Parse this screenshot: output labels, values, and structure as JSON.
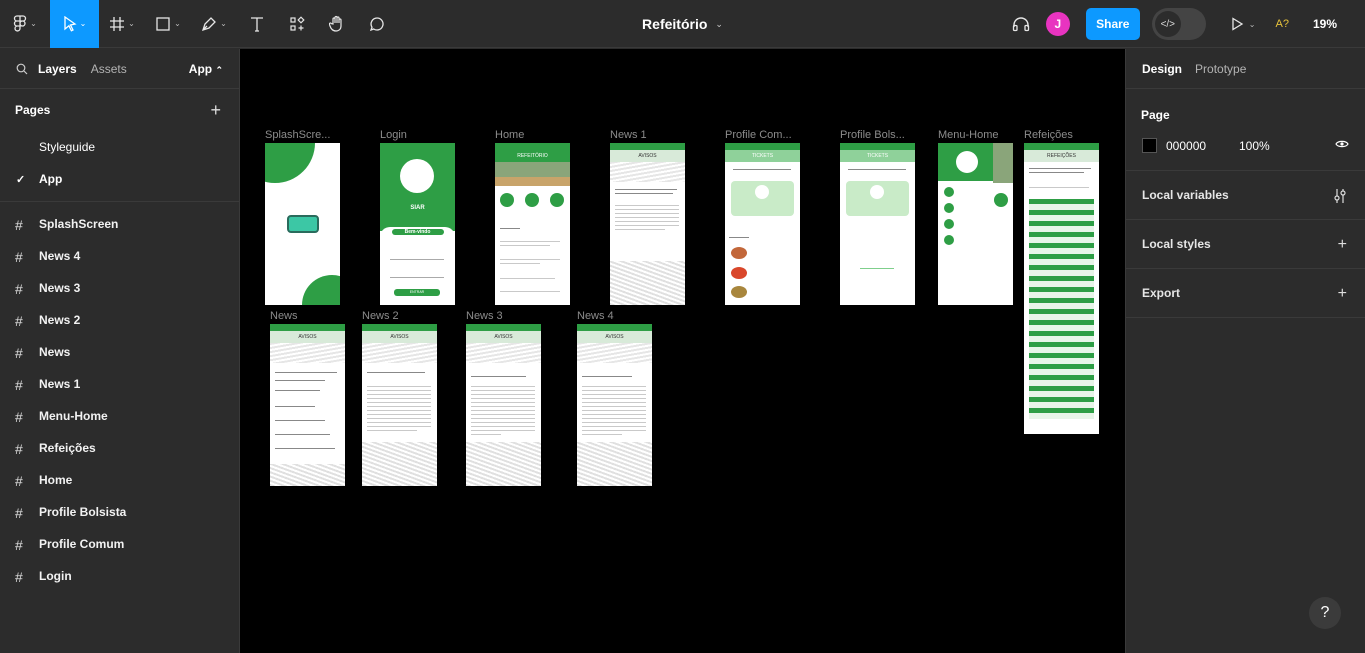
{
  "file": {
    "title": "Refeitório"
  },
  "toolbar": {
    "tools": [
      "main-menu",
      "move",
      "frame",
      "shape",
      "pen",
      "text",
      "resources",
      "hand",
      "comment"
    ],
    "avatar_initial": "J",
    "share_label": "Share",
    "font_warning": "A?",
    "zoom": "19%"
  },
  "left_panel": {
    "tabs": {
      "layers": "Layers",
      "assets": "Assets"
    },
    "page_selector": "App",
    "pages_title": "Pages",
    "pages": [
      {
        "label": "Styleguide",
        "selected": false
      },
      {
        "label": "App",
        "selected": true
      }
    ],
    "layers": [
      "SplashScreen",
      "News 4",
      "News 3",
      "News 2",
      "News",
      "News 1",
      "Menu-Home",
      "Refeições",
      "Home",
      "Profile Bolsista",
      "Profile Comum",
      "Login"
    ]
  },
  "canvas": {
    "frames_row1": [
      "SplashScre...",
      "Login",
      "Home",
      "News 1",
      "Profile Com...",
      "Profile Bols...",
      "Menu-Home",
      "Refeições"
    ],
    "frames_row2": [
      "News",
      "News 2",
      "News 3",
      "News 4"
    ],
    "mock_texts": {
      "avisos": "AVISOS",
      "tickets": "TICKETS",
      "refeitorio": "REFEITÓRIO",
      "refeicoes": "REFEIÇÕES",
      "siar": "SIAR",
      "bemvindo": "Bem-vindo",
      "entrar": "ENTRAR"
    }
  },
  "right_panel": {
    "tabs": {
      "design": "Design",
      "prototype": "Prototype"
    },
    "page_section_title": "Page",
    "page_color": "000000",
    "page_opacity": "100%",
    "sections": [
      "Local variables",
      "Local styles",
      "Export"
    ]
  },
  "help_label": "?",
  "colors": {
    "accent": "#0d99ff",
    "avatar": "#e834c0",
    "frame_green": "#2e9e45",
    "canvas": "#000000",
    "ui_bg": "#2c2c2c"
  }
}
